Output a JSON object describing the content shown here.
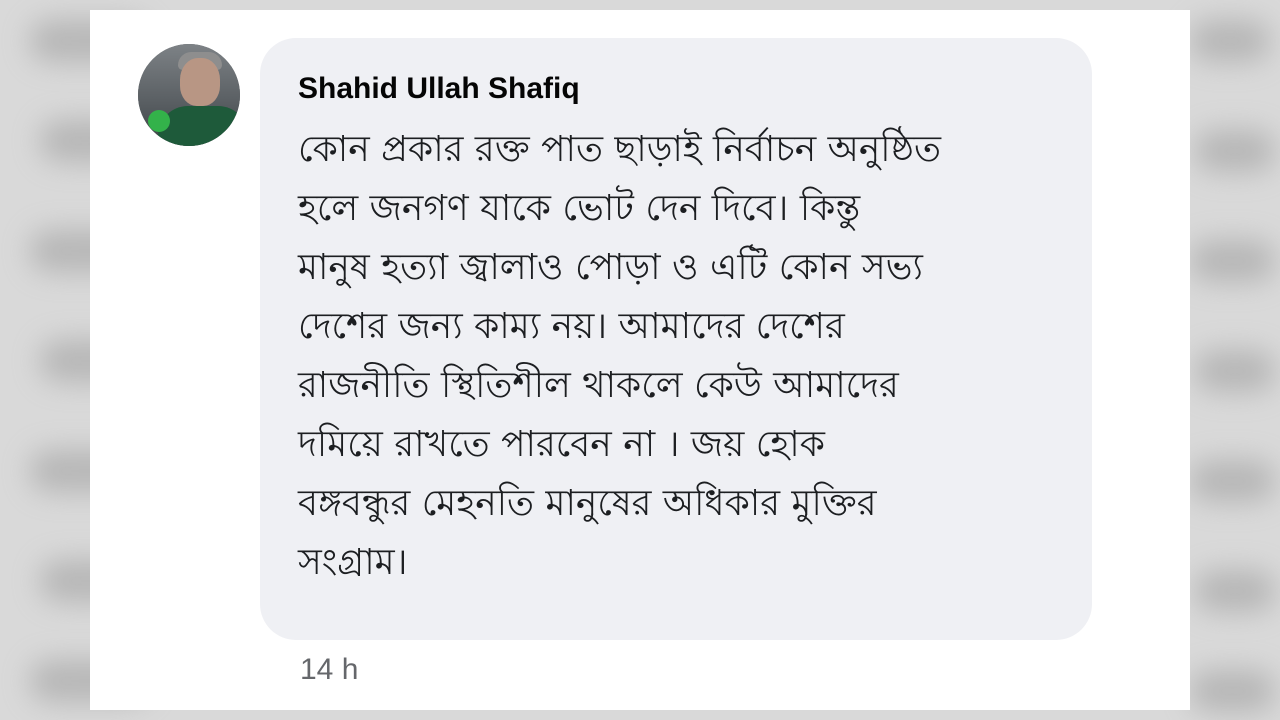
{
  "comment": {
    "author": "Shahid Ullah Shafiq",
    "text_lines": [
      "কোন প্রকার রক্ত পাত ছাড়াই নির্বাচন অনুষ্ঠিত",
      "হলে জনগণ যাকে ভোট দেন দিবে। কিন্তু",
      "মানুষ হত্যা জ্বালাও পোড়া ও এটি কোন সভ্য",
      "দেশের জন্য কাম্য নয়। আমাদের দেশের",
      "রাজনীতি স্থিতিশীল থাকলে কেউ আমাদের",
      "দমিয়ে রাখতে পারবেন না । জয় হোক",
      "বঙ্গবন্ধুর মেহনতি মানুষের অধিকার মুক্তির",
      "সংগ্রাম।"
    ],
    "timestamp": "14 h"
  },
  "colors": {
    "bubble": "#eff0f4",
    "author_text": "#050505",
    "meta_text": "#65676b"
  },
  "icons": {
    "avatar": "profile-photo"
  }
}
